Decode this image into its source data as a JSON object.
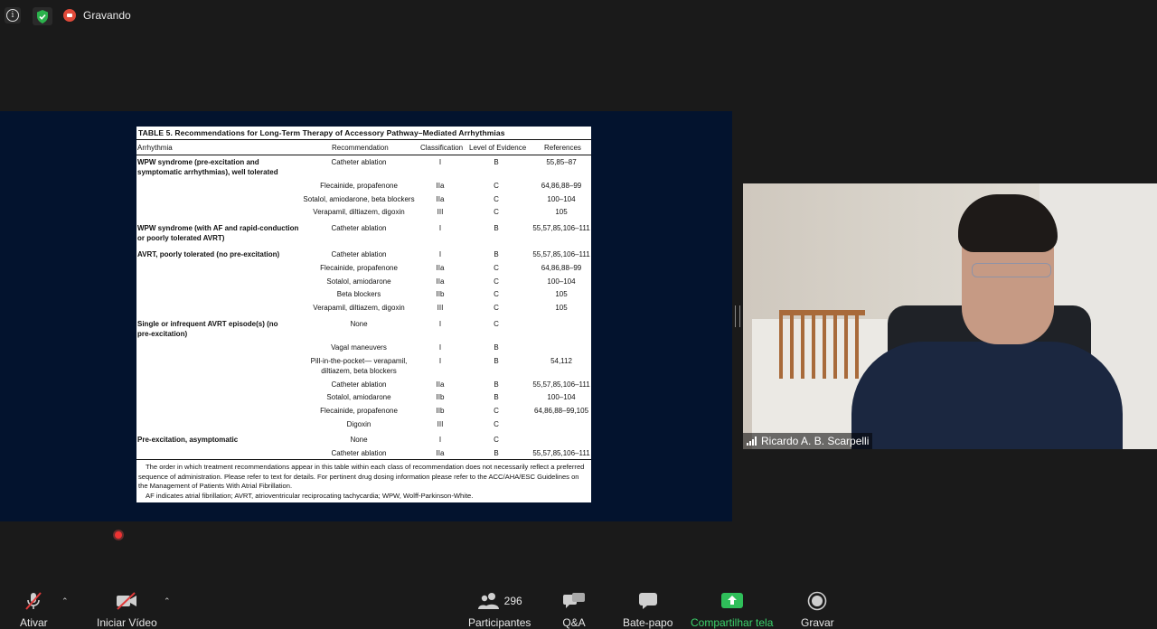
{
  "top": {
    "recording_label": "Gravando"
  },
  "slide": {
    "title": "TABLE 5.   Recommendations for Long-Term Therapy of Accessory Pathway–Mediated Arrhythmias",
    "headers": [
      "Arrhythmia",
      "Recommendation",
      "Classification",
      "Level of Evidence",
      "References"
    ],
    "rows": [
      {
        "arr1": "WPW syndrome (pre-excitation and",
        "arr2": "symptomatic arrhythmias), well tolerated",
        "rec": "Catheter ablation",
        "cls": "I",
        "loe": "B",
        "ref": "55,85–87"
      },
      {
        "arr1": "",
        "arr2": "",
        "rec": "Flecainide, propafenone",
        "cls": "IIa",
        "loe": "C",
        "ref": "64,86,88–99"
      },
      {
        "arr1": "",
        "arr2": "",
        "rec": "Sotalol, amiodarone, beta blockers",
        "cls": "IIa",
        "loe": "C",
        "ref": "100–104"
      },
      {
        "arr1": "",
        "arr2": "",
        "rec": "Verapamil, diltiazem, digoxin",
        "cls": "III",
        "loe": "C",
        "ref": "105"
      },
      {
        "arr1": "WPW syndrome (with AF and rapid-conduction",
        "arr2": "or poorly tolerated AVRT)",
        "rec": "Catheter ablation",
        "cls": "I",
        "loe": "B",
        "ref": "55,57,85,106–111"
      },
      {
        "arr1": "AVRT, poorly tolerated (no pre-excitation)",
        "arr2": "",
        "rec": "Catheter ablation",
        "cls": "I",
        "loe": "B",
        "ref": "55,57,85,106–111"
      },
      {
        "arr1": "",
        "arr2": "",
        "rec": "Flecainide, propafenone",
        "cls": "IIa",
        "loe": "C",
        "ref": "64,86,88–99"
      },
      {
        "arr1": "",
        "arr2": "",
        "rec": "Sotalol, amiodarone",
        "cls": "IIa",
        "loe": "C",
        "ref": "100–104"
      },
      {
        "arr1": "",
        "arr2": "",
        "rec": "Beta blockers",
        "cls": "IIb",
        "loe": "C",
        "ref": "105"
      },
      {
        "arr1": "",
        "arr2": "",
        "rec": "Verapamil, diltiazem, digoxin",
        "cls": "III",
        "loe": "C",
        "ref": "105"
      },
      {
        "arr1": "Single or infrequent AVRT episode(s) (no",
        "arr2": "pre-excitation)",
        "rec": "None",
        "cls": "I",
        "loe": "C",
        "ref": ""
      },
      {
        "arr1": "",
        "arr2": "",
        "rec": "Vagal maneuvers",
        "cls": "I",
        "loe": "B",
        "ref": ""
      },
      {
        "arr1": "",
        "arr2": "",
        "rec": "Pill-in-the-pocket— verapamil,",
        "rec2": "diltiazem, beta blockers",
        "cls": "I",
        "loe": "B",
        "ref": "54,112"
      },
      {
        "arr1": "",
        "arr2": "",
        "rec": "Catheter ablation",
        "cls": "IIa",
        "loe": "B",
        "ref": "55,57,85,106–111"
      },
      {
        "arr1": "",
        "arr2": "",
        "rec": "Sotalol, amiodarone",
        "cls": "IIb",
        "loe": "B",
        "ref": "100–104"
      },
      {
        "arr1": "",
        "arr2": "",
        "rec": "Flecainide, propafenone",
        "cls": "IIb",
        "loe": "C",
        "ref": "64,86,88–99,105"
      },
      {
        "arr1": "",
        "arr2": "",
        "rec": "Digoxin",
        "cls": "III",
        "loe": "C",
        "ref": ""
      },
      {
        "arr1": "Pre-excitation, asymptomatic",
        "arr2": "",
        "rec": "None",
        "cls": "I",
        "loe": "C",
        "ref": ""
      },
      {
        "arr1": "",
        "arr2": "",
        "rec": "Catheter ablation",
        "cls": "IIa",
        "loe": "B",
        "ref": "55,57,85,106–111"
      }
    ],
    "footnote1": "The order in which treatment recommendations appear in this table within each class of recommendation does not necessarily reflect a preferred sequence of administration. Please refer to text for details. For pertinent drug dosing information please refer to the ACC/AHA/ESC Guidelines on the Management of Patients With Atrial Fibrillation.",
    "footnote2": "AF indicates atrial fibrillation; AVRT, atrioventricular reciprocating tachycardia; WPW, Wolff-Parkinson-White."
  },
  "video": {
    "participant_name": "Ricardo A. B. Scarpelli"
  },
  "toolbar": {
    "mute_label": "Ativar",
    "video_label": "Iniciar Vídeo",
    "participants_label": "Participantes",
    "participants_count": "296",
    "qa_label": "Q&A",
    "chat_label": "Bate-papo",
    "share_label": "Compartilhar tela",
    "record_label": "Gravar"
  },
  "colors": {
    "share_green": "#3bd36b",
    "recording_red": "#e04a3a",
    "slide_bg": "#03132e"
  }
}
